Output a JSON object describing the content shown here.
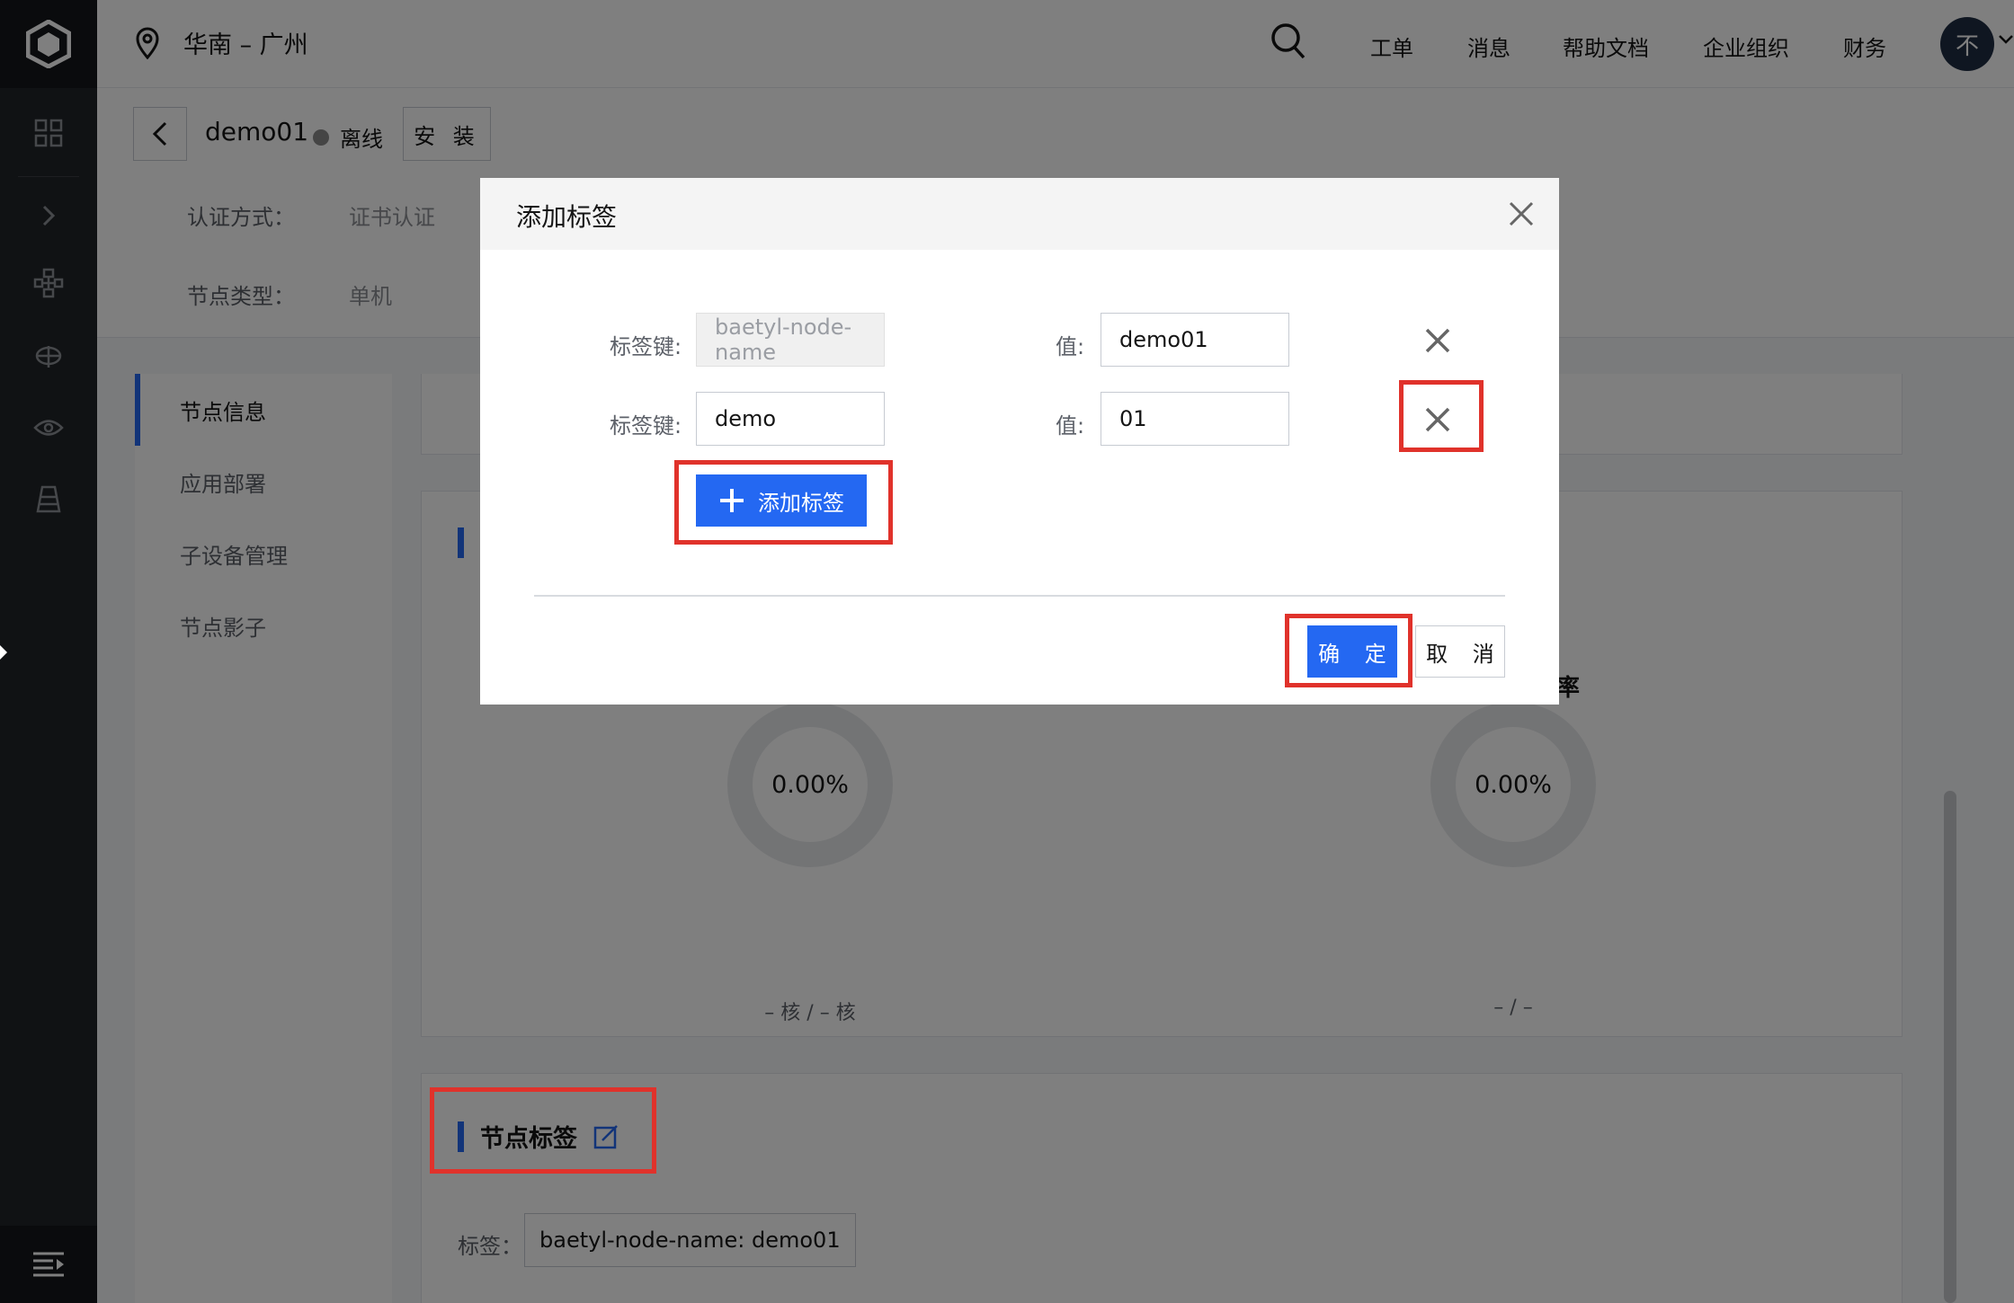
{
  "topbar": {
    "region": "华南 – 广州",
    "nav": [
      "工单",
      "消息",
      "帮助文档",
      "企业组织",
      "财务"
    ],
    "avatar_text": "不"
  },
  "node": {
    "name": "demo01",
    "status": "离线",
    "install_label": "安 装",
    "auth_key": "认证方式：",
    "auth_value": "证书认证",
    "type_key": "节点类型：",
    "type_value": "单机"
  },
  "menu": {
    "items": [
      "节点信息",
      "应用部署",
      "子设备管理",
      "节点影子"
    ],
    "active_index": 0
  },
  "monitor": {
    "cpu_value": "0.00%",
    "cpu_sub": "– 核 / – 核",
    "mem_value": "0.00%",
    "mem_sub": "– / –",
    "rate_label_fragment": "率"
  },
  "tags_card": {
    "title": "节点标签",
    "tag_label": "标签：",
    "tag_value": "baetyl-node-name: demo01"
  },
  "modal": {
    "title": "添加标签",
    "rows": [
      {
        "key_label": "标签键:",
        "key_value": "baetyl-node-name",
        "key_disabled": true,
        "value_label": "值:",
        "value": "demo01"
      },
      {
        "key_label": "标签键:",
        "key_value": "demo",
        "key_disabled": false,
        "value_label": "值:",
        "value": "01"
      }
    ],
    "add_label": "添加标签",
    "ok_label": "确 定",
    "cancel_label": "取 消"
  },
  "colors": {
    "primary": "#2468f2",
    "highlight": "#e0322b",
    "rail": "#212428"
  }
}
